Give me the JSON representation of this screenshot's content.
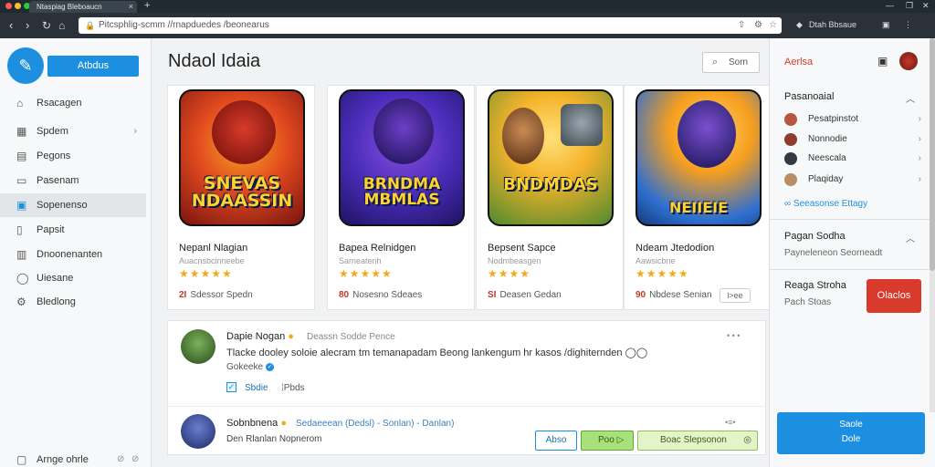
{
  "browser": {
    "tab_title": "Ntaspiag Bleboaucn",
    "url": "Pitcsphlig-scmm //rnapduedes /beonearus",
    "extension_label": "Dtah Bbsaue",
    "new_tab": "+",
    "close": "×"
  },
  "sidebar": {
    "brand_button": "Atbdus",
    "items": [
      {
        "label": "Rsacagen",
        "icon": "home-icon"
      },
      {
        "label": "Spdem",
        "icon": "grid-icon",
        "chevron": "›"
      },
      {
        "label": "Pegons",
        "icon": "doc-icon"
      },
      {
        "label": "Pasenam",
        "icon": "folder-icon"
      },
      {
        "label": "Sopenenso",
        "icon": "list-icon",
        "active": true
      },
      {
        "label": "Papsit",
        "icon": "file-icon"
      },
      {
        "label": "Dnoonenanten",
        "icon": "table-icon"
      },
      {
        "label": "Uiesane",
        "icon": "user-icon"
      },
      {
        "label": "Bledlong",
        "icon": "settings-icon"
      }
    ],
    "footer": "Arnge ohrle"
  },
  "main": {
    "title": "Ndaol Idaia",
    "search_label": "Sorn",
    "cards": [
      {
        "art_title": "SNEVAS NDAASSIN",
        "name": "Nepanl Nlagian",
        "sub": "Auacnsbcinneebe",
        "stars": "★★★★★",
        "count": "2I",
        "foot": "Sdessor Spedn",
        "art_colors": [
          "#f7a521",
          "#d5261b"
        ]
      },
      {
        "art_title": "BRNDMA MBMLAS",
        "name": "Bapea Relnidgen",
        "sub": "Sarneatenh",
        "stars": "★★★★★",
        "count": "80",
        "foot": "Nosesno Sdeaes",
        "art_colors": [
          "#4a2dba",
          "#f08a1e"
        ]
      },
      {
        "art_title": "BNDMDAS",
        "name": "Bepsent Sapce",
        "sub": "Nodmbeasgen",
        "stars": "★★★★",
        "count": "SI",
        "foot": "Deasen Gedan",
        "art_colors": [
          "#f5b32b",
          "#4e8a2e"
        ]
      },
      {
        "art_title": "NEIIEIE",
        "name": "Ndeam Jtedodion",
        "sub": "Aawsicbne",
        "stars": "★★★★★",
        "count": "90",
        "foot": "Nbdese Senian",
        "art_colors": [
          "#2e6fd0",
          "#f59e1f"
        ],
        "mini_button": "l>ee"
      }
    ],
    "feed": {
      "post1": {
        "name": "Dapie Nogan",
        "meta": "Deassn Sodde Pence",
        "text": "Tlacke dooley soloie alecram tm temanapadam Beong lankengum hr kasos /dighiternden",
        "link": "Gokeeke",
        "check_label": "Sbdie",
        "tag": "Pbds"
      },
      "post2": {
        "name": "Sobnbnena",
        "meta": "Sedaeeean (Dedsl) - Sonlan) - Danlan)",
        "sub": "Den Rlanlan Nopnerom",
        "btn1": "Abso",
        "btn2": "Poo ▷",
        "btn3": "Boac Slepsonon"
      }
    }
  },
  "right_panel": {
    "top_title": "Aerlsa",
    "section1_title": "Pasanoaial",
    "rows": [
      {
        "label": "Pesatpinstot",
        "color": "#b8573f"
      },
      {
        "label": "Nonnodie",
        "color": "#8e3c2e"
      },
      {
        "label": "Neescala",
        "color": "#333a44"
      },
      {
        "label": "Plaqiday",
        "color": "#b98d66"
      }
    ],
    "link": "Seeasonse Ettagy",
    "section2_title": "Pagan Sodha",
    "section2_sub": "Payneleneon Seorneadt",
    "section3_title": "Reaga Stroha",
    "section3_sub": "Pach Stoas",
    "red_button": "Olaclos",
    "blue_button_line1": "Saole",
    "blue_button_line2": "Dole"
  }
}
